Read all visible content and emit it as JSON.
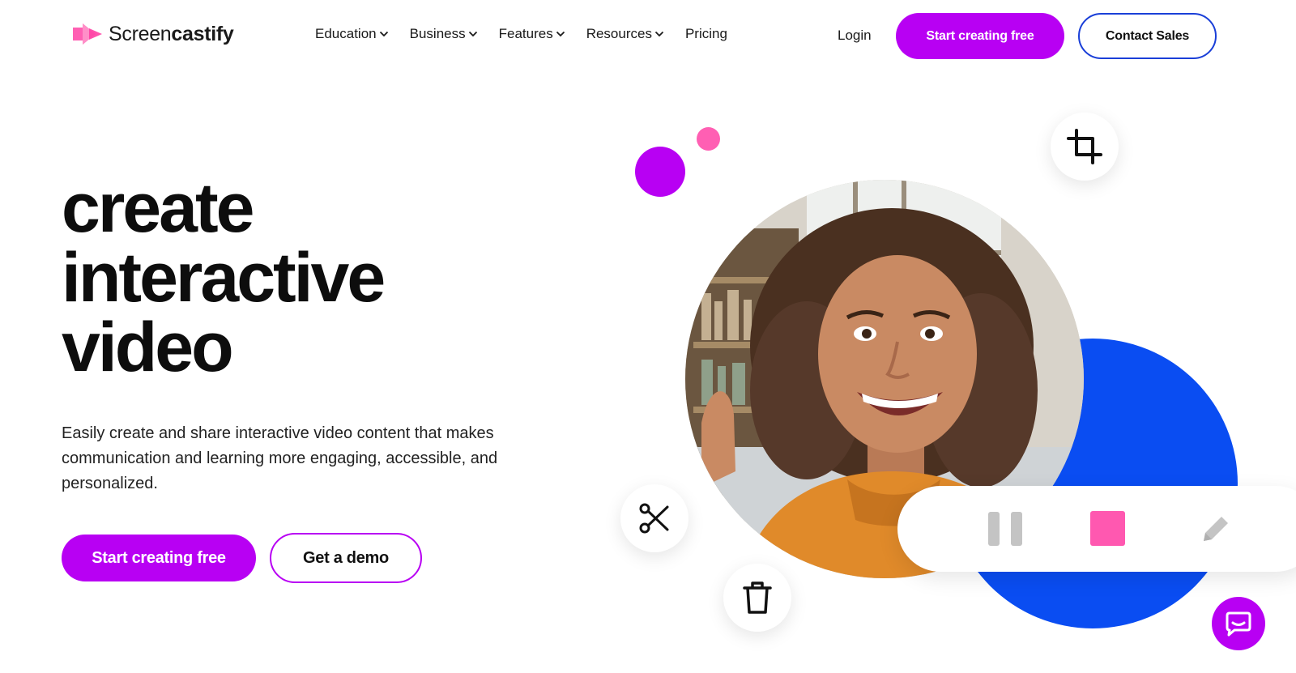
{
  "brand": {
    "name_light": "Screen",
    "name_bold": "castify",
    "logo_icon": "screencastify-logo-icon",
    "primary_color": "#b800f3",
    "accent_pink": "#ff5fb3",
    "accent_blue": "#0a4df2"
  },
  "nav": {
    "items": [
      {
        "label": "Education",
        "has_dropdown": true
      },
      {
        "label": "Business",
        "has_dropdown": true
      },
      {
        "label": "Features",
        "has_dropdown": true
      },
      {
        "label": "Resources",
        "has_dropdown": true
      },
      {
        "label": "Pricing",
        "has_dropdown": false
      }
    ],
    "login_label": "Login",
    "cta_primary_label": "Start creating free",
    "cta_secondary_label": "Contact Sales"
  },
  "hero": {
    "headline_lines": [
      "create",
      "interactive",
      "video"
    ],
    "subtext": "Easily create and share interactive video content that makes communication and learning more engaging, accessible, and personalized.",
    "cta_primary_label": "Start creating free",
    "cta_secondary_label": "Get a demo"
  },
  "illustration": {
    "icons": [
      "crop-icon",
      "scissors-icon",
      "trash-icon",
      "pause-icon",
      "stop-icon",
      "pencil-icon"
    ],
    "chat_icon": "chat-icon"
  }
}
